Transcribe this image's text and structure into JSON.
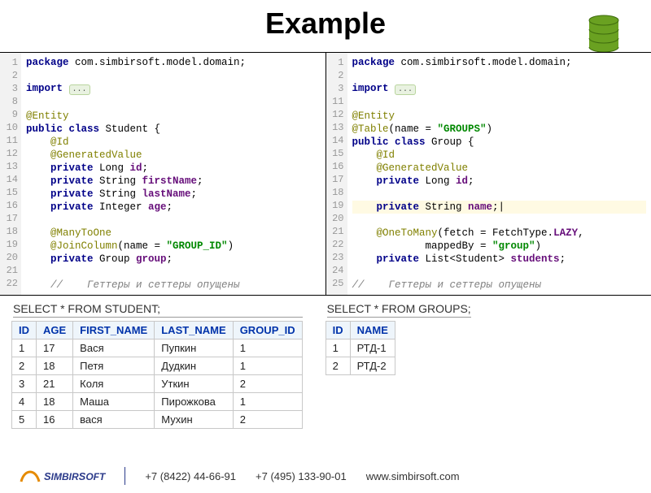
{
  "title": "Example",
  "code_left": {
    "gutter": [
      "1",
      "2",
      "3",
      "8",
      "9",
      "10",
      "11",
      "12",
      "13",
      "14",
      "15",
      "16",
      "17",
      "18",
      "19",
      "20",
      "21",
      "22"
    ],
    "lines": [
      {
        "p": [
          {
            "t": "package ",
            "c": "kw"
          },
          {
            "t": "com.simbirsoft.model.domain;",
            "c": "type"
          }
        ]
      },
      {
        "p": [
          {
            "t": " "
          }
        ]
      },
      {
        "p": [
          {
            "t": "import ",
            "c": "kw"
          },
          {
            "t": "...",
            "c": "fold"
          }
        ]
      },
      {
        "p": [
          {
            "t": " "
          }
        ]
      },
      {
        "p": [
          {
            "t": "@Entity",
            "c": "ann"
          }
        ]
      },
      {
        "p": [
          {
            "t": "public class ",
            "c": "kw"
          },
          {
            "t": "Student {",
            "c": "type"
          }
        ]
      },
      {
        "p": [
          {
            "t": "    @Id",
            "c": "ann"
          }
        ]
      },
      {
        "p": [
          {
            "t": "    @GeneratedValue",
            "c": "ann"
          }
        ]
      },
      {
        "p": [
          {
            "t": "    private ",
            "c": "kw"
          },
          {
            "t": "Long ",
            "c": "type"
          },
          {
            "t": "id",
            "c": "field"
          },
          {
            "t": ";",
            "c": "type"
          }
        ]
      },
      {
        "p": [
          {
            "t": "    private ",
            "c": "kw"
          },
          {
            "t": "String ",
            "c": "type"
          },
          {
            "t": "firstName",
            "c": "field"
          },
          {
            "t": ";",
            "c": "type"
          }
        ]
      },
      {
        "p": [
          {
            "t": "    private ",
            "c": "kw"
          },
          {
            "t": "String ",
            "c": "type"
          },
          {
            "t": "lastName",
            "c": "field"
          },
          {
            "t": ";",
            "c": "type"
          }
        ]
      },
      {
        "p": [
          {
            "t": "    private ",
            "c": "kw"
          },
          {
            "t": "Integer ",
            "c": "type"
          },
          {
            "t": "age",
            "c": "field"
          },
          {
            "t": ";",
            "c": "type"
          }
        ]
      },
      {
        "p": [
          {
            "t": " "
          }
        ]
      },
      {
        "p": [
          {
            "t": "    @ManyToOne",
            "c": "ann"
          }
        ]
      },
      {
        "p": [
          {
            "t": "    @JoinColumn",
            "c": "ann"
          },
          {
            "t": "(name = ",
            "c": "type"
          },
          {
            "t": "\"GROUP_ID\"",
            "c": "str"
          },
          {
            "t": ")",
            "c": "type"
          }
        ]
      },
      {
        "p": [
          {
            "t": "    private ",
            "c": "kw"
          },
          {
            "t": "Group ",
            "c": "type"
          },
          {
            "t": "group",
            "c": "field"
          },
          {
            "t": ";",
            "c": "type"
          }
        ]
      },
      {
        "p": [
          {
            "t": " "
          }
        ]
      },
      {
        "p": [
          {
            "t": "    //    Геттеры и сеттеры опущены",
            "c": "comment"
          }
        ]
      }
    ]
  },
  "code_right": {
    "gutter": [
      "1",
      "2",
      "3",
      "11",
      "12",
      "13",
      "14",
      "15",
      "16",
      "17",
      "18",
      "19",
      "20",
      "21",
      "22",
      "23",
      "24",
      "25"
    ],
    "lines": [
      {
        "p": [
          {
            "t": "package ",
            "c": "kw"
          },
          {
            "t": "com.simbirsoft.model.domain;",
            "c": "type"
          }
        ]
      },
      {
        "p": [
          {
            "t": " "
          }
        ]
      },
      {
        "p": [
          {
            "t": "import ",
            "c": "kw"
          },
          {
            "t": "...",
            "c": "fold"
          }
        ]
      },
      {
        "p": [
          {
            "t": " "
          }
        ]
      },
      {
        "p": [
          {
            "t": "@Entity",
            "c": "ann"
          }
        ]
      },
      {
        "p": [
          {
            "t": "@Table",
            "c": "ann"
          },
          {
            "t": "(name = ",
            "c": "type"
          },
          {
            "t": "\"GROUPS\"",
            "c": "str"
          },
          {
            "t": ")",
            "c": "type"
          }
        ]
      },
      {
        "p": [
          {
            "t": "public class ",
            "c": "kw"
          },
          {
            "t": "Group {",
            "c": "type"
          }
        ]
      },
      {
        "p": [
          {
            "t": "    @Id",
            "c": "ann"
          }
        ]
      },
      {
        "p": [
          {
            "t": "    @GeneratedValue",
            "c": "ann"
          }
        ]
      },
      {
        "p": [
          {
            "t": "    private ",
            "c": "kw"
          },
          {
            "t": "Long ",
            "c": "type"
          },
          {
            "t": "id",
            "c": "field"
          },
          {
            "t": ";",
            "c": "type"
          }
        ]
      },
      {
        "p": [
          {
            "t": " "
          }
        ]
      },
      {
        "hl": true,
        "p": [
          {
            "t": "    private ",
            "c": "kw"
          },
          {
            "t": "String ",
            "c": "type"
          },
          {
            "t": "name",
            "c": "field"
          },
          {
            "t": ";|",
            "c": "type"
          }
        ]
      },
      {
        "p": [
          {
            "t": " "
          }
        ]
      },
      {
        "p": [
          {
            "t": "    @OneToMany",
            "c": "ann"
          },
          {
            "t": "(fetch = FetchType.",
            "c": "type"
          },
          {
            "t": "LAZY",
            "c": "field"
          },
          {
            "t": ",",
            "c": "type"
          }
        ]
      },
      {
        "p": [
          {
            "t": "            mappedBy = ",
            "c": "type"
          },
          {
            "t": "\"group\"",
            "c": "str"
          },
          {
            "t": ")",
            "c": "type"
          }
        ]
      },
      {
        "p": [
          {
            "t": "    private ",
            "c": "kw"
          },
          {
            "t": "List<Student> ",
            "c": "type"
          },
          {
            "t": "students",
            "c": "field"
          },
          {
            "t": ";",
            "c": "type"
          }
        ]
      },
      {
        "p": [
          {
            "t": " "
          }
        ]
      },
      {
        "p": [
          {
            "t": "//    Геттеры и сеттеры опущены",
            "c": "comment"
          }
        ]
      }
    ]
  },
  "table_left": {
    "title": "SELECT * FROM STUDENT;",
    "headers": [
      "ID",
      "AGE",
      "FIRST_NAME",
      "LAST_NAME",
      "GROUP_ID"
    ],
    "rows": [
      [
        "1",
        "17",
        "Вася",
        "Пупкин",
        "1"
      ],
      [
        "2",
        "18",
        "Петя",
        "Дудкин",
        "1"
      ],
      [
        "3",
        "21",
        "Коля",
        "Уткин",
        "2"
      ],
      [
        "4",
        "18",
        "Маша",
        "Пирожкова",
        "1"
      ],
      [
        "5",
        "16",
        "вася",
        "Мухин",
        "2"
      ]
    ]
  },
  "table_right": {
    "title": "SELECT * FROM GROUPS;",
    "headers": [
      "ID",
      "NAME"
    ],
    "rows": [
      [
        "1",
        "РТД-1"
      ],
      [
        "2",
        "РТД-2"
      ]
    ]
  },
  "footer": {
    "logo": "SimbirSoft",
    "phone1": "+7 (8422) 44-66-91",
    "phone2": "+7 (495) 133-90-01",
    "site": "www.simbirsoft.com"
  }
}
